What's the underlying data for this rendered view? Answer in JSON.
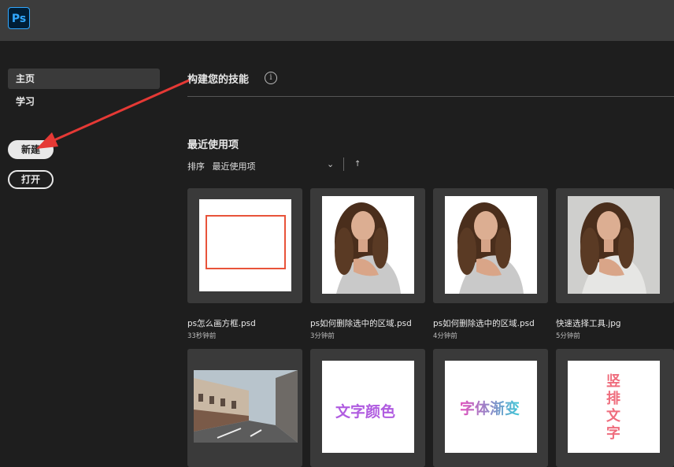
{
  "app": {
    "logo_text": "Ps",
    "logo_color": "#31a8ff"
  },
  "sidebar": {
    "items": [
      {
        "label": "主页",
        "active": true
      },
      {
        "label": "学习",
        "active": false
      }
    ],
    "new_button": "新建",
    "open_button": "打开"
  },
  "main": {
    "skills_title": "构建您的技能",
    "info_icon": "i",
    "recent_title": "最近使用项",
    "sort_label": "排序",
    "sort_value": "最近使用项",
    "sort_chevron": "⌄",
    "sort_direction_icon": "↑",
    "files": [
      {
        "name": "ps怎么画方框.psd",
        "time": "33秒钟前",
        "thumb": "red-rectangle"
      },
      {
        "name": "ps如何删除选中的区域.psd",
        "time": "3分钟前",
        "thumb": "portrait"
      },
      {
        "name": "ps如何删除选中的区域.psd",
        "time": "4分钟前",
        "thumb": "portrait"
      },
      {
        "name": "快速选择工具.jpg",
        "time": "5分钟前",
        "thumb": "portrait-gray"
      },
      {
        "name": "",
        "time": "",
        "thumb": "street"
      },
      {
        "name": "",
        "time": "",
        "thumb": "text",
        "thumb_text": "文字颜色"
      },
      {
        "name": "",
        "time": "",
        "thumb": "text",
        "thumb_text": "字体渐变"
      },
      {
        "name": "",
        "time": "",
        "thumb": "text",
        "thumb_text": "竖排文字"
      }
    ]
  },
  "colors": {
    "annotation_arrow": "#e53935",
    "thumb_rect": "#e8533a",
    "text_purple": "#b05ce0",
    "text_gradient_pink": "#e24dbb",
    "text_gradient_cyan": "#3ec7d6",
    "text_vertical": "#ef6d7d"
  }
}
